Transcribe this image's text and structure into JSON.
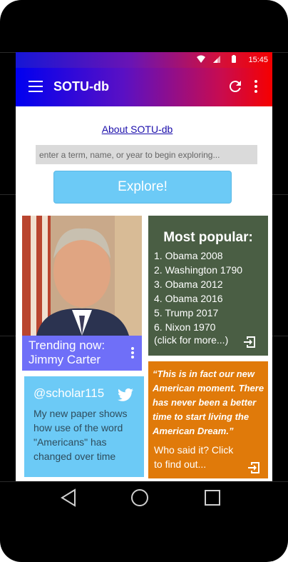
{
  "status_bar": {
    "time": "15:45"
  },
  "toolbar": {
    "title": "SOTU-db",
    "menu_icon": "hamburger-menu-icon",
    "refresh_icon": "refresh-icon",
    "overflow_icon": "more-vert-icon"
  },
  "main": {
    "about_link": "About SOTU-db",
    "search": {
      "placeholder": "enter a term, name, or year to begin exploring...",
      "value": ""
    },
    "explore_label": "Explore!"
  },
  "trending": {
    "label": "Trending now: Jimmy Carter"
  },
  "popular": {
    "title": "Most popular:",
    "items": [
      "1. Obama 2008",
      "2. Washington 1790",
      "3. Obama 2012",
      "4. Obama 2016",
      "5. Trump 2017",
      "6. Nixon 1970"
    ],
    "more": "(click for more...)"
  },
  "scholar": {
    "handle": "@scholar115",
    "text": "My new paper shows how use of the word \"Americans\" has changed over time"
  },
  "quote": {
    "text": "“This is in fact our new American moment. There has never been a better time to start living the American Dream.”",
    "prompt": "Who said it? Click to find out..."
  },
  "colors": {
    "explore": "#6ccaf6",
    "trending": "#6f6ff8",
    "popular": "#4a5e44",
    "scholar": "#6ccaf6",
    "quote": "#e07a0a"
  }
}
